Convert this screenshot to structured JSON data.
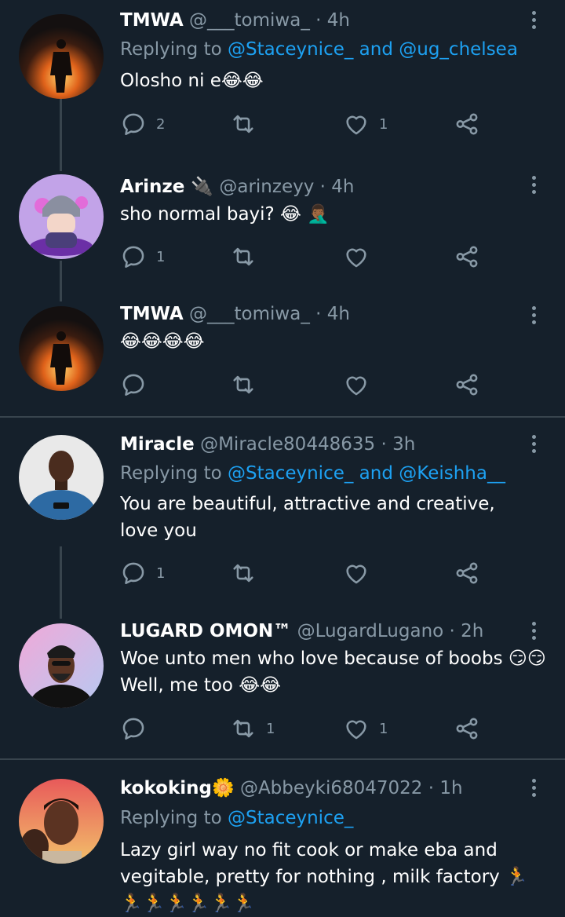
{
  "tweets": [
    {
      "name": "TMWA",
      "handle": "@___tomiwa_",
      "time": "4h",
      "replying_label": "Replying to",
      "replying_to": "@Staceynice_ and @ug_chelsea",
      "text": "Olosho ni e😂😂",
      "replies": "2",
      "retweets": "",
      "likes": "1"
    },
    {
      "name": "Arinze 🔌",
      "handle": "@arinzeyy",
      "time": "4h",
      "text": "sho normal bayi? 😂 🤦🏾‍♂️",
      "replies": "1",
      "retweets": "",
      "likes": ""
    },
    {
      "name": "TMWA",
      "handle": "@___tomiwa_",
      "time": "4h",
      "text": "😂😂😂😂",
      "replies": "",
      "retweets": "",
      "likes": ""
    },
    {
      "name": "Miracle",
      "handle": "@Miracle80448635",
      "time": "3h",
      "replying_label": "Replying to",
      "replying_to": "@Staceynice_ and @Keishha__",
      "text": "You are beautiful, attractive and creative, love you",
      "replies": "1",
      "retweets": "",
      "likes": ""
    },
    {
      "name": "LUGARD OMON™",
      "handle": "@LugardLugano",
      "time": "2h",
      "text_line1": "Woe unto men who love because of boobs 😏😏",
      "text_line2": "Well, me too 😂😂",
      "replies": "",
      "retweets": "1",
      "likes": "1"
    },
    {
      "name": "kokoking🌼",
      "handle": "@Abbeyki68047022",
      "time": "1h",
      "replying_label": "Replying to",
      "replying_to": "@Staceynice_",
      "text": "Lazy girl way no fit cook or make eba and vegitable, pretty for nothing , milk factory 🏃🏃🏃🏃🏃🏃🏃",
      "replies": "",
      "retweets": "",
      "likes": ""
    }
  ],
  "dot": "·",
  "colors": {
    "background": "#15202b",
    "muted": "#8899a6",
    "link": "#1da1f2",
    "divider": "#38444d"
  }
}
